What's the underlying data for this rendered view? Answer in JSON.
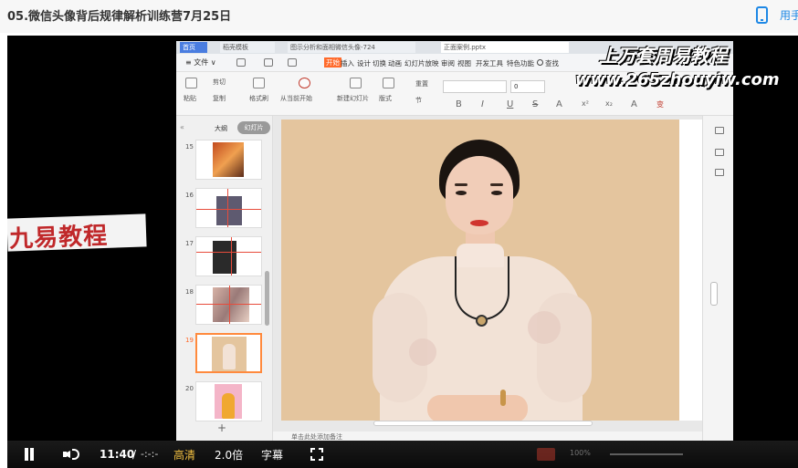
{
  "page": {
    "title": "05.微信头像背后规律解析训练营7月25日",
    "app_link_label": "用手",
    "phone_icon": "phone-icon"
  },
  "wps": {
    "tabs": [
      "首页",
      "稻壳模板",
      "图示分析和面相微信头像-724",
      "正面案例.pptx"
    ],
    "file_menu": "≡ 文件 ∨",
    "ribbon_tabs": [
      "开始",
      "插入",
      "设计",
      "切换",
      "动画",
      "幻灯片放映",
      "审阅",
      "视图",
      "开发工具",
      "特色功能"
    ],
    "active_ribbon_tab": "开始",
    "search_label": "查找",
    "toolbar": {
      "paste": "粘贴",
      "cut": "剪切",
      "copy": "复制",
      "format_painter": "格式刷",
      "play_from_current": "从当前开始",
      "new_slide": "新建幻灯片",
      "layout": "版式",
      "reset": "重置",
      "section": "节",
      "font_size": "0"
    },
    "format_buttons": [
      "B",
      "I",
      "U",
      "S",
      "A",
      "x²",
      "x₂",
      "A",
      "变"
    ],
    "side_panel": {
      "outline_tab": "大纲",
      "slides_tab": "幻灯片",
      "slides": [
        {
          "number": "15"
        },
        {
          "number": "16"
        },
        {
          "number": "17"
        },
        {
          "number": "18"
        },
        {
          "number": "19"
        },
        {
          "number": "20"
        }
      ],
      "selected_slide": "19",
      "add_slide": "+"
    },
    "notes_placeholder": "单击此处添加备注",
    "zoom": "100%"
  },
  "watermarks": {
    "top": "上万套周易教程",
    "url": "www.265zhouyiw.com",
    "left": "九易教程"
  },
  "player": {
    "current_time": "11:40",
    "separator": "/",
    "total_time": "-:-:-",
    "quality": "高清",
    "speed": "2.0倍",
    "subtitles": "字幕",
    "icons": [
      "pause-icon",
      "volume-icon",
      "fullscreen-icon"
    ]
  },
  "colors": {
    "accent_blue": "#1e88e5",
    "wps_orange": "#ff6a2b",
    "quality_gold": "#f5c242",
    "slide_background": "#e4c59e"
  }
}
